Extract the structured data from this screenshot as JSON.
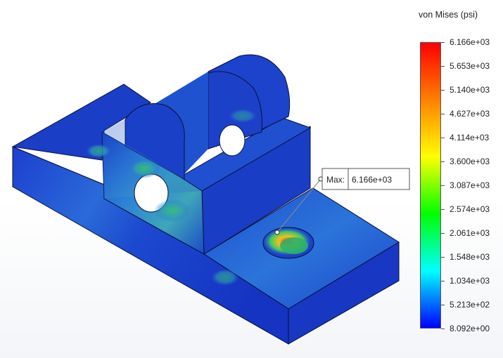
{
  "legend": {
    "title": "von Mises (psi)",
    "ticks": [
      "6.166e+03",
      "5.653e+03",
      "5.140e+03",
      "4.627e+03",
      "4.114e+03",
      "3.600e+03",
      "3.087e+03",
      "2.574e+03",
      "2.061e+03",
      "1.548e+03",
      "1.034e+03",
      "5.213e+02",
      "8.092e+00"
    ],
    "min_value": 8.092,
    "max_value": 6166,
    "gradient_colors": [
      "#ff0000",
      "#ff8000",
      "#ffff00",
      "#00ff00",
      "#00ffff",
      "#0000ff"
    ]
  },
  "probe": {
    "label": "Max:",
    "value": "6.166e+03"
  },
  "colors": {
    "low": "#1432c8",
    "mid": "#22b4a0",
    "high": "#e8341a",
    "edge": "#07113a"
  }
}
